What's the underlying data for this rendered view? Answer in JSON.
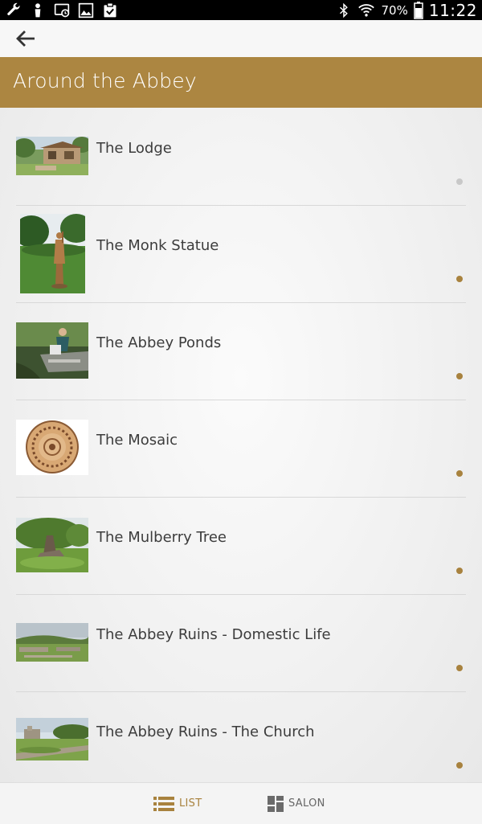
{
  "status_bar": {
    "left_icons": [
      "wrench-icon",
      "person-icon",
      "cast-icon",
      "image-icon",
      "clipboard-check-icon"
    ],
    "bluetooth_icon": "bluetooth-icon",
    "wifi_icon": "wifi-icon",
    "battery_percent": "70%",
    "battery_level": 0.7,
    "time": "11:22"
  },
  "action_bar": {
    "back_icon": "arrow-left-icon"
  },
  "header": {
    "title": "Around the Abbey",
    "color": "#ac8641"
  },
  "list": {
    "items": [
      {
        "label": "The Lodge",
        "thumbnail": "lodge-thumbnail",
        "indicator": "grey"
      },
      {
        "label": "The Monk Statue",
        "thumbnail": "monk-statue-thumbnail",
        "indicator": "gold"
      },
      {
        "label": "The Abbey Ponds",
        "thumbnail": "abbey-ponds-thumbnail",
        "indicator": "gold"
      },
      {
        "label": "The Mosaic",
        "thumbnail": "mosaic-thumbnail",
        "indicator": "gold"
      },
      {
        "label": "The Mulberry Tree",
        "thumbnail": "mulberry-tree-thumbnail",
        "indicator": "gold"
      },
      {
        "label": "The Abbey Ruins - Domestic Life",
        "thumbnail": "ruins-domestic-thumbnail",
        "indicator": "gold"
      },
      {
        "label": "The Abbey Ruins - The Church",
        "thumbnail": "ruins-church-thumbnail",
        "indicator": "gold"
      }
    ]
  },
  "bottom_nav": {
    "list_label": "LIST",
    "list_icon": "list-icon",
    "salon_label": "SALON",
    "salon_icon": "grid-icon",
    "active": "list",
    "active_color": "#a8823e"
  }
}
